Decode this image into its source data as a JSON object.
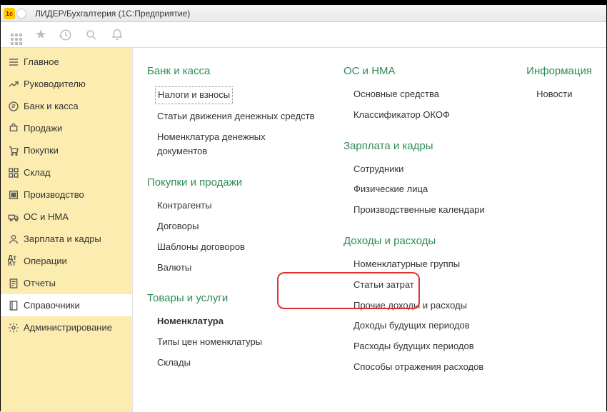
{
  "title": "ЛИДЕР/Бухгалтерия  (1С:Предприятие)",
  "sidebar": {
    "items": [
      {
        "label": "Главное",
        "icon": "menu"
      },
      {
        "label": "Руководителю",
        "icon": "chart"
      },
      {
        "label": "Банк и касса",
        "icon": "ruble"
      },
      {
        "label": "Продажи",
        "icon": "cart"
      },
      {
        "label": "Покупки",
        "icon": "basket"
      },
      {
        "label": "Склад",
        "icon": "boxes"
      },
      {
        "label": "Производство",
        "icon": "factory"
      },
      {
        "label": "ОС и НМА",
        "icon": "truck"
      },
      {
        "label": "Зарплата и кадры",
        "icon": "person"
      },
      {
        "label": "Операции",
        "icon": "dtkt"
      },
      {
        "label": "Отчеты",
        "icon": "report"
      },
      {
        "label": "Справочники",
        "icon": "book"
      },
      {
        "label": "Администрирование",
        "icon": "gear"
      }
    ],
    "active_index": 11
  },
  "content": {
    "col1": [
      {
        "head": "Банк и касса",
        "links": [
          {
            "text": "Налоги и взносы",
            "dotted": true
          },
          {
            "text": "Статьи движения денежных средств"
          },
          {
            "text": "Номенклатура денежных документов"
          }
        ]
      },
      {
        "head": "Покупки и продажи",
        "links": [
          {
            "text": "Контрагенты"
          },
          {
            "text": "Договоры"
          },
          {
            "text": "Шаблоны договоров"
          },
          {
            "text": "Валюты"
          }
        ]
      },
      {
        "head": "Товары и услуги",
        "links": [
          {
            "text": "Номенклатура",
            "bold": true
          },
          {
            "text": "Типы цен номенклатуры"
          },
          {
            "text": "Склады"
          }
        ]
      }
    ],
    "col2": [
      {
        "head": "ОС и НМА",
        "links": [
          {
            "text": "Основные средства"
          },
          {
            "text": "Классификатор ОКОФ"
          }
        ]
      },
      {
        "head": "Зарплата и кадры",
        "links": [
          {
            "text": "Сотрудники"
          },
          {
            "text": "Физические лица"
          },
          {
            "text": "Производственные календари"
          }
        ]
      },
      {
        "head": "Доходы и расходы",
        "links": [
          {
            "text": "Номенклатурные группы"
          },
          {
            "text": "Статьи затрат"
          },
          {
            "text": "Прочие доходы и расходы"
          },
          {
            "text": "Доходы будущих периодов"
          },
          {
            "text": "Расходы будущих периодов"
          },
          {
            "text": "Способы отражения расходов"
          }
        ]
      }
    ],
    "col3": [
      {
        "head": "Информация",
        "links": [
          {
            "text": "Новости"
          }
        ]
      }
    ]
  }
}
